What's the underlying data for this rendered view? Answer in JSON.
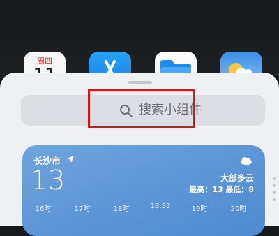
{
  "home_screen": {
    "calendar_app": {
      "weekday": "周四",
      "date": "11"
    }
  },
  "widget_sheet": {
    "search": {
      "placeholder": "搜索小组件"
    }
  },
  "weather_widget": {
    "city": "长沙市",
    "temperature": "13",
    "condition": "大部多云",
    "high_low": "最高：13 最低：8",
    "hours": [
      "16时",
      "17时",
      "18时",
      "18:33",
      "19时",
      "20时"
    ]
  },
  "colors": {
    "highlight_border": "#d3141b",
    "sheet_background": "#eef0f4",
    "widget_background": "#5e98d8"
  }
}
